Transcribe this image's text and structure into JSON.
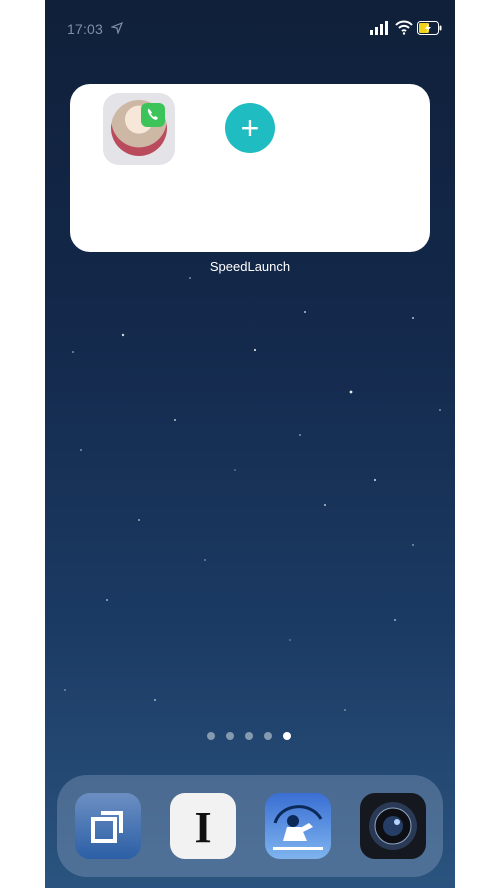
{
  "status_bar": {
    "time": "17:03",
    "icons": [
      "location-arrow-icon",
      "signal-icon",
      "wifi-icon",
      "battery-charging-icon"
    ]
  },
  "widget": {
    "label": "SpeedLaunch",
    "items": [
      {
        "type": "contact",
        "icon": "phone-icon"
      },
      {
        "type": "add",
        "label": "+"
      }
    ]
  },
  "page_dots": {
    "count": 5,
    "active_index": 4
  },
  "dock": {
    "apps": [
      {
        "icon": "square-stack-icon"
      },
      {
        "icon": "instapaper-i-icon",
        "glyph": "I"
      },
      {
        "icon": "reader-under-tree-icon"
      },
      {
        "icon": "camera-lens-icon"
      }
    ]
  },
  "colors": {
    "accent": "#1fbcc1",
    "phone_badge": "#3cc35a"
  }
}
